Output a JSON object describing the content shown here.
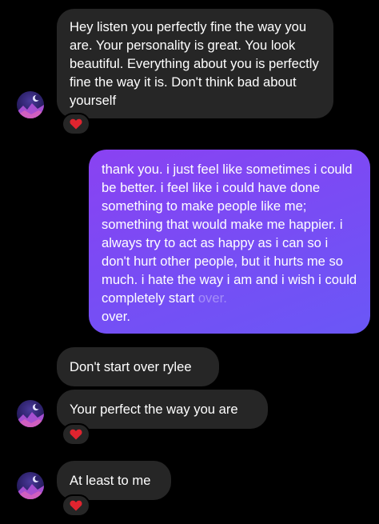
{
  "thread": {
    "messages": [
      {
        "sender": "them",
        "text": "Hey listen you perfectly fine the way you are. Your personality is great. You look beautiful. Everything about you is perfectly fine the way it is. Don't think bad about yourself",
        "reaction": "heart"
      },
      {
        "sender": "me",
        "text": "thank you. i just feel like sometimes i could be better. i feel like i could have done something to make people like me; something that would make me happier. i always try to act as happy as i can so i don't hurt other people, but it hurts me so much. i hate the way i am and i wish i could completely start",
        "faded_tail": "over.",
        "last_line": "over."
      },
      {
        "sender": "them",
        "text": "Don't start over rylee"
      },
      {
        "sender": "them",
        "text": "Your perfect the way you are",
        "reaction": "heart"
      },
      {
        "sender": "them",
        "text": "At least to me",
        "reaction": "heart"
      }
    ]
  },
  "colors": {
    "background": "#000000",
    "incoming_bubble": "#262626",
    "outgoing_bubble_start": "#8a42f2",
    "outgoing_bubble_end": "#6a57f6",
    "reaction_heart": "#e0242f"
  },
  "icons": {
    "reaction": "heart-icon",
    "avatar": "avatar-icon"
  }
}
